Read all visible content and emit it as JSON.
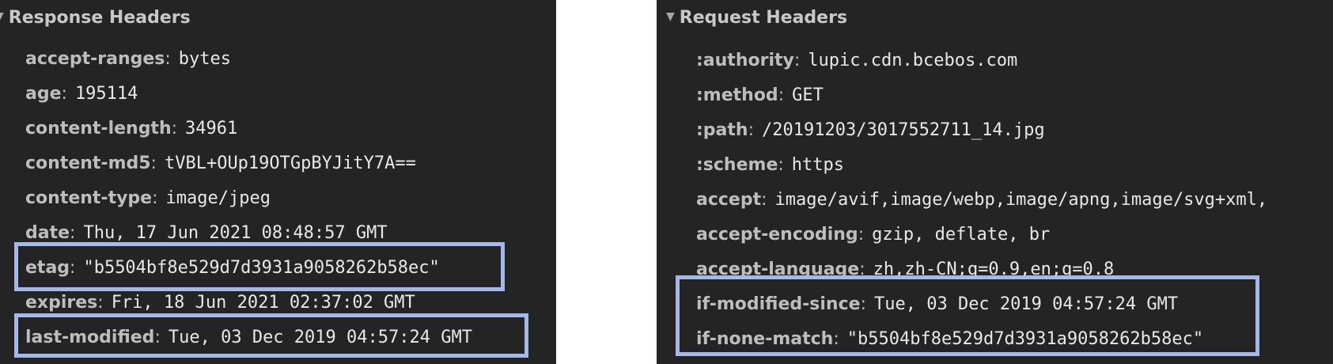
{
  "response_headers": {
    "title": "Response Headers",
    "rows": [
      {
        "name": "accept-ranges",
        "value": "bytes"
      },
      {
        "name": "age",
        "value": "195114"
      },
      {
        "name": "content-length",
        "value": "34961"
      },
      {
        "name": "content-md5",
        "value": "tVBL+OUp19OTGpBYJitY7A=="
      },
      {
        "name": "content-type",
        "value": "image/jpeg"
      },
      {
        "name": "date",
        "value": "Thu, 17 Jun 2021 08:48:57 GMT"
      },
      {
        "name": "etag",
        "value": "\"b5504bf8e529d7d3931a9058262b58ec\""
      },
      {
        "name": "expires",
        "value": "Fri, 18 Jun 2021 02:37:02 GMT"
      },
      {
        "name": "last-modified",
        "value": "Tue, 03 Dec 2019 04:57:24 GMT"
      }
    ]
  },
  "request_headers": {
    "title": "Request Headers",
    "rows": [
      {
        "name": ":authority",
        "value": "lupic.cdn.bcebos.com"
      },
      {
        "name": ":method",
        "value": "GET"
      },
      {
        "name": ":path",
        "value": "/20191203/3017552711_14.jpg"
      },
      {
        "name": ":scheme",
        "value": "https"
      },
      {
        "name": "accept",
        "value": "image/avif,image/webp,image/apng,image/svg+xml,"
      },
      {
        "name": "accept-encoding",
        "value": "gzip, deflate, br"
      },
      {
        "name": "accept-language",
        "value": "zh,zh-CN;q=0.9,en;q=0.8"
      },
      {
        "name": "if-modified-since",
        "value": "Tue, 03 Dec 2019 04:57:24 GMT"
      },
      {
        "name": "if-none-match",
        "value": "\"b5504bf8e529d7d3931a9058262b58ec\""
      }
    ]
  },
  "colors": {
    "panel_background": "#242424",
    "highlight_border": "#a3b9ea",
    "header_name": "#bdbdbd",
    "header_value": "#e8e8e8"
  },
  "icons": {
    "section_toggle": "triangle-down-icon"
  }
}
